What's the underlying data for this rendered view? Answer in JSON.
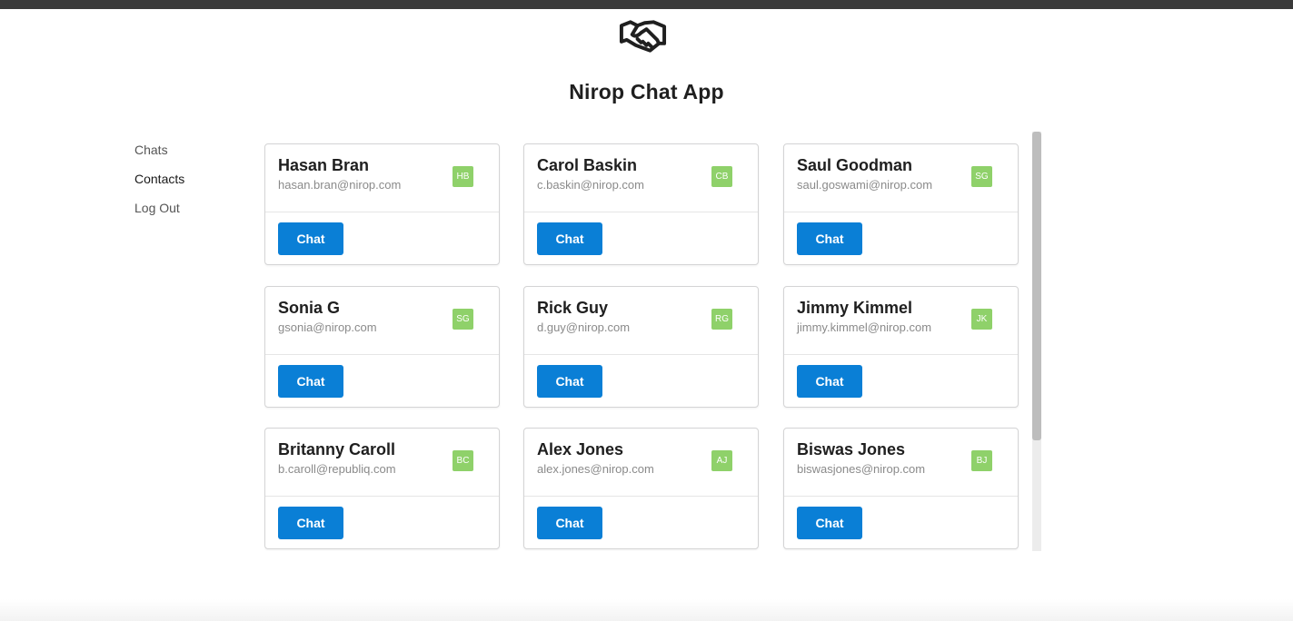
{
  "app": {
    "title": "Nirop Chat App",
    "logo_icon": "handshake-icon"
  },
  "nav": {
    "items": [
      {
        "label": "Chats",
        "active": false
      },
      {
        "label": "Contacts",
        "active": true
      },
      {
        "label": "Log Out",
        "active": false
      }
    ]
  },
  "contacts": [
    {
      "name": "Hasan Bran",
      "email": "hasan.bran@nirop.com",
      "initials": "HB",
      "action": "Chat"
    },
    {
      "name": "Carol Baskin",
      "email": "c.baskin@nirop.com",
      "initials": "CB",
      "action": "Chat"
    },
    {
      "name": "Saul Goodman",
      "email": "saul.goswami@nirop.com",
      "initials": "SG",
      "action": "Chat"
    },
    {
      "name": "Sonia G",
      "email": "gsonia@nirop.com",
      "initials": "SG",
      "action": "Chat"
    },
    {
      "name": "Rick Guy",
      "email": "d.guy@nirop.com",
      "initials": "RG",
      "action": "Chat"
    },
    {
      "name": "Jimmy Kimmel",
      "email": "jimmy.kimmel@nirop.com",
      "initials": "JK",
      "action": "Chat"
    },
    {
      "name": "Britanny Caroll",
      "email": "b.caroll@republiq.com",
      "initials": "BC",
      "action": "Chat"
    },
    {
      "name": "Alex Jones",
      "email": "alex.jones@nirop.com",
      "initials": "AJ",
      "action": "Chat"
    },
    {
      "name": "Biswas Jones",
      "email": "biswasjones@nirop.com",
      "initials": "BJ",
      "action": "Chat"
    }
  ],
  "colors": {
    "accent": "#0a7fd6",
    "badge": "#8fd16a",
    "topbar": "#3a3a3a"
  }
}
